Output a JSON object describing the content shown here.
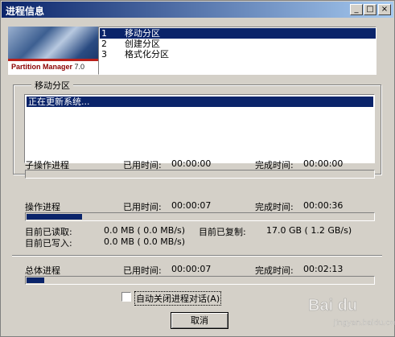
{
  "window": {
    "title": "进程信息",
    "controls": {
      "minimize": "_",
      "maximize": "□",
      "close": "×"
    }
  },
  "banner": {
    "logo_prefix": "Partition Manager",
    "logo_version": "7.0"
  },
  "steps": [
    {
      "num": "1",
      "label": "移动分区",
      "selected": true
    },
    {
      "num": "2",
      "label": "创建分区",
      "selected": false
    },
    {
      "num": "3",
      "label": "格式化分区",
      "selected": false
    }
  ],
  "group": {
    "legend": "移动分区",
    "log_lines": [
      "正在更新系统..."
    ]
  },
  "sub_operation": {
    "label": "子操作进程",
    "elapsed_label": "已用时间:",
    "elapsed": "00:00:00",
    "completion_label": "完成时间:",
    "completion": "00:00:00",
    "progress": 0
  },
  "operation": {
    "label": "操作进程",
    "elapsed_label": "已用时间:",
    "elapsed": "00:00:07",
    "completion_label": "完成时间:",
    "completion": "00:00:36",
    "progress": 0.16,
    "read_label": "目前已读取:",
    "read_value": "0.0 MB ( 0.0 MB/s)",
    "write_label": "目前已写入:",
    "write_value": "0.0 MB ( 0.0 MB/s)",
    "copied_label": "目前已复制:",
    "copied_value": "17.0 GB ( 1.2 GB/s)"
  },
  "total": {
    "label": "总体进程",
    "elapsed_label": "已用时间:",
    "elapsed": "00:00:07",
    "completion_label": "完成时间:",
    "completion": "00:02:13",
    "progress": 0.05
  },
  "auto_close": {
    "label": "自动关闭进程对话(A)",
    "checked": false
  },
  "cancel_button": "取消",
  "watermark": {
    "line1": "Bai du",
    "line2": "jingyan.baidu.com"
  },
  "colors": {
    "selection": "#0a246a",
    "face": "#d4d0c8",
    "title_start": "#0a246a",
    "title_end": "#a6caf0"
  }
}
